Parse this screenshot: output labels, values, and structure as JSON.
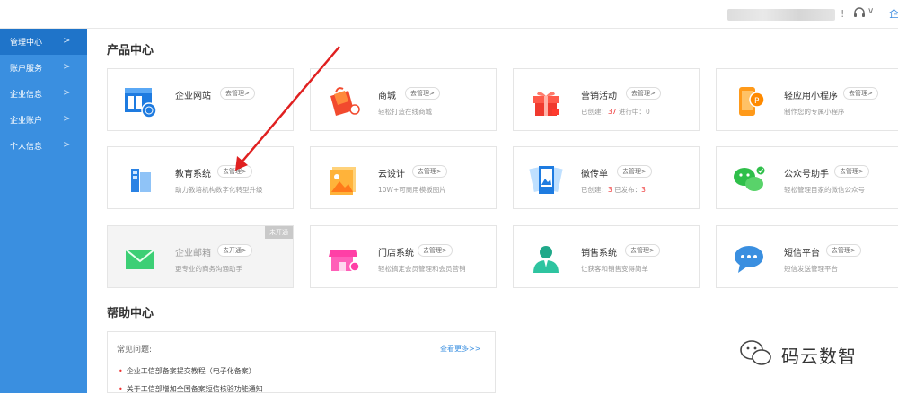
{
  "topbar": {
    "separator": "!",
    "chevron": "∨",
    "right_char": "企"
  },
  "sidebar": {
    "items": [
      {
        "label": "管理中心",
        "active": true
      },
      {
        "label": "账户服务"
      },
      {
        "label": "企业信息"
      },
      {
        "label": "企业账户"
      },
      {
        "label": "个人信息"
      }
    ],
    "arrow": ">"
  },
  "product_center": {
    "title": "产品中心",
    "cards": [
      {
        "name": "企业网站",
        "action": "去管理>",
        "desc": "",
        "icon": "website-icon"
      },
      {
        "name": "商城",
        "action": "去管理>",
        "desc": "轻松打造在线商城",
        "icon": "shop-bag-icon"
      },
      {
        "name": "营销活动",
        "action": "去管理>",
        "desc_pre": "已创建：",
        "desc_n1": "37",
        "desc_mid": " 进行中：",
        "desc_n2": "0",
        "icon": "gift-icon"
      },
      {
        "name": "轻应用小程序",
        "action": "去管理>",
        "desc": "制作您的专属小程序",
        "icon": "mini-program-icon"
      },
      {
        "name": "教育系统",
        "action": "去管理>",
        "desc": "助力教培机构数字化转型升级",
        "icon": "education-book-icon"
      },
      {
        "name": "云设计",
        "action": "去管理>",
        "desc": "10W+可商用模板图片",
        "icon": "image-design-icon"
      },
      {
        "name": "微传单",
        "action": "去管理>",
        "desc_pre": "已创建：",
        "desc_n1": "3",
        "desc_mid": " 已发布：",
        "desc_n2": "3",
        "icon": "flyer-icon"
      },
      {
        "name": "公众号助手",
        "action": "去管理>",
        "desc": "轻松管理目家的微信公众号",
        "icon": "wechat-icon"
      },
      {
        "name": "企业邮箱",
        "action": "去开通>",
        "desc": "更专业的商务沟通助手",
        "badge": "未开通",
        "icon": "mail-icon"
      },
      {
        "name": "门店系统",
        "action": "去管理>",
        "desc": "轻松搞定会员管理和会员营销",
        "icon": "store-icon"
      },
      {
        "name": "销售系统",
        "action": "去管理>",
        "desc": "让获客和销售变得简单",
        "icon": "sales-person-icon"
      },
      {
        "name": "短信平台",
        "action": "去管理>",
        "desc": "短信发送管理平台",
        "icon": "sms-bubble-icon"
      }
    ]
  },
  "help_center": {
    "title": "帮助中心",
    "label": "常见问题:",
    "more": "查看更多>>",
    "links": [
      "企业工信部备案提交教程（电子化备案）",
      "关于工信部增加全国备案短信核验功能通知"
    ]
  },
  "watermark": {
    "text": "码云数智"
  },
  "colors": {
    "sidebar": "#3a8fe0",
    "sidebar_active": "#1f74c9",
    "accent_red": "#e33333",
    "arrow_red": "#e02020"
  }
}
